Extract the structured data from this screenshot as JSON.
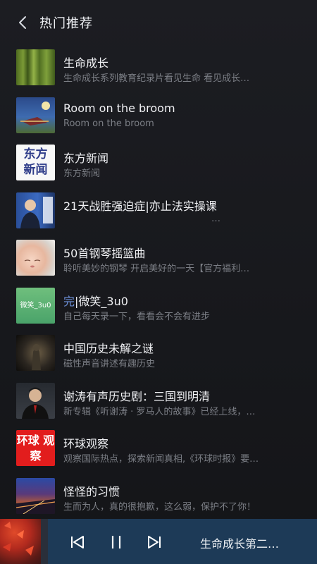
{
  "header": {
    "title": "热门推荐"
  },
  "items": [
    {
      "title": "生命成长",
      "subtitle": "生命成长系列教育纪录片看见生命 看见成长…",
      "thumb": "bamboo-image"
    },
    {
      "title": "Room on the broom",
      "subtitle": "Room on the broom",
      "thumb": "book-cover-image"
    },
    {
      "title": "东方新闻",
      "subtitle": "东方新闻",
      "thumb": "east-news-logo",
      "thumb_text": "东方 新闻"
    },
    {
      "title": "21天战胜强迫症|亦止法实操课",
      "subtitle": "",
      "more": "…",
      "thumb": "course-cover-image"
    },
    {
      "title": "50首钢琴摇篮曲",
      "subtitle": "聆听美妙的钢琴 开启美好的一天【官方福利…",
      "thumb": "baby-image"
    },
    {
      "title_tag": "完",
      "title": "|微笑_3u0",
      "subtitle": "自己每天录一下，看看会不会有进步",
      "thumb": "smile-cover-image",
      "thumb_text": "微笑_3u0"
    },
    {
      "title": "中国历史未解之谜",
      "subtitle": "磁性声音讲述有趣历史",
      "thumb": "history-image"
    },
    {
      "title": "谢涛有声历史剧：三国到明清",
      "subtitle": "新专辑《听谢涛 · 罗马人的故事》已经上线，…",
      "thumb": "portrait-image"
    },
    {
      "title": "环球观察",
      "subtitle": "观察国际热点，探索新闻真相,《环球时报》要…",
      "thumb": "huanqiu-logo",
      "thumb_text": "环球 观察"
    },
    {
      "title": "怪怪的习惯",
      "subtitle": "生而为人，真的很抱歉，这么弱，保护不了你！",
      "thumb": "city-night-image"
    }
  ],
  "player": {
    "now_playing": "生命成长第二…"
  }
}
